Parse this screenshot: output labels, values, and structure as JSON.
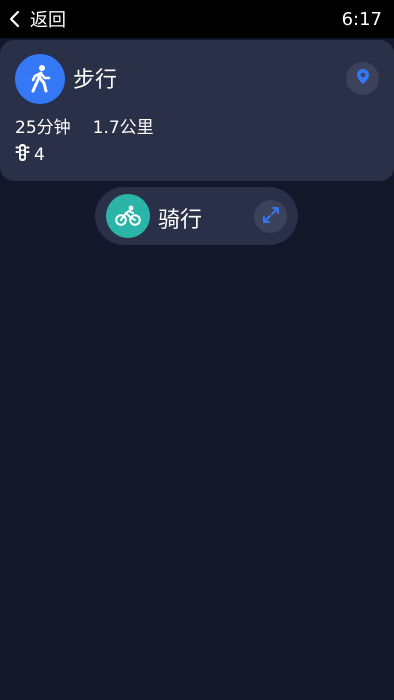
{
  "status_bar": {
    "back_label": "返回",
    "time": "6:17"
  },
  "walk_card": {
    "mode_label": "步行",
    "duration": "25分钟",
    "distance": "1.7公里",
    "traffic_lights": "4",
    "icons": {
      "mode": "walking-person-icon",
      "location": "location-pin-icon",
      "traffic": "traffic-light-icon"
    },
    "colors": {
      "mode_icon_bg": "#3478f6",
      "location_pin": "#3478f6"
    }
  },
  "ride_chip": {
    "mode_label": "骑行",
    "icons": {
      "mode": "bicycle-icon",
      "expand": "expand-arrows-icon"
    },
    "colors": {
      "mode_icon_bg": "#2ab5a8",
      "expand_arrows": "#3478f6"
    }
  }
}
